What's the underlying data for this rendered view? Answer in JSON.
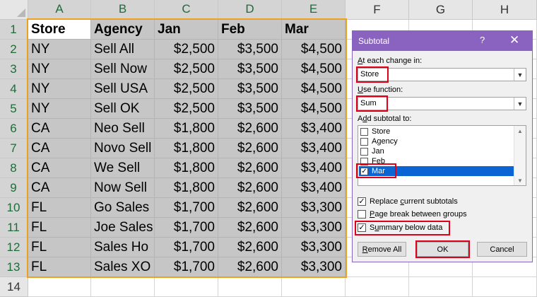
{
  "sheet": {
    "columns": [
      "A",
      "B",
      "C",
      "D",
      "E",
      "F",
      "G",
      "H"
    ],
    "rows": [
      "1",
      "2",
      "3",
      "4",
      "5",
      "6",
      "7",
      "8",
      "9",
      "10",
      "11",
      "12",
      "13",
      "14"
    ],
    "headers": [
      "Store",
      "Agency",
      "Jan",
      "Feb",
      "Mar"
    ],
    "data": [
      [
        "NY",
        "Sell All",
        "$2,500",
        "$3,500",
        "$4,500"
      ],
      [
        "NY",
        "Sell Now",
        "$2,500",
        "$3,500",
        "$4,500"
      ],
      [
        "NY",
        "Sell USA",
        "$2,500",
        "$3,500",
        "$4,500"
      ],
      [
        "NY",
        "Sell OK",
        "$2,500",
        "$3,500",
        "$4,500"
      ],
      [
        "CA",
        "Neo Sell",
        "$1,800",
        "$2,600",
        "$3,400"
      ],
      [
        "CA",
        "Novo Sell",
        "$1,800",
        "$2,600",
        "$3,400"
      ],
      [
        "CA",
        "We Sell",
        "$1,800",
        "$2,600",
        "$3,400"
      ],
      [
        "CA",
        "Now Sell",
        "$1,800",
        "$2,600",
        "$3,400"
      ],
      [
        "FL",
        "Go Sales",
        "$1,700",
        "$2,600",
        "$3,300"
      ],
      [
        "FL",
        "Joe Sales",
        "$1,700",
        "$2,600",
        "$3,300"
      ],
      [
        "FL",
        "Sales Ho",
        "$1,700",
        "$2,600",
        "$3,300"
      ],
      [
        "FL",
        "Sales XO",
        "$1,700",
        "$2,600",
        "$3,300"
      ]
    ]
  },
  "dialog": {
    "title": "Subtotal",
    "help": "?",
    "close": "✕",
    "at_each_change_label": "At each change in:",
    "at_each_change_value": "Store",
    "use_function_label": "Use function:",
    "use_function_value": "Sum",
    "add_subtotal_label": "Add subtotal to:",
    "subtotal_fields": [
      {
        "label": "Store",
        "checked": false
      },
      {
        "label": "Agency",
        "checked": false
      },
      {
        "label": "Jan",
        "checked": false
      },
      {
        "label": "Feb",
        "checked": false
      },
      {
        "label": "Mar",
        "checked": true
      }
    ],
    "replace_label": "Replace current subtotals",
    "page_break_label": "Page break between groups",
    "summary_label": "Summary below data",
    "remove_all_label": "Remove All",
    "ok_label": "OK",
    "cancel_label": "Cancel"
  },
  "colors": {
    "selection_border": "#f0a020",
    "dialog_accent": "#8a62c0",
    "highlight_red": "#e0001a",
    "list_highlight": "#0a64d4"
  }
}
